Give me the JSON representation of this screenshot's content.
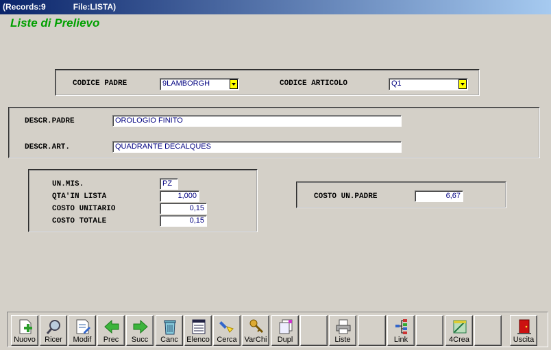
{
  "titlebar": {
    "records": "(Records:9",
    "file": "File:LISTA)"
  },
  "heading": "Liste di Prelievo",
  "codici": {
    "codice_padre_label": "CODICE PADRE",
    "codice_padre_value": "9LAMBORGH",
    "codice_articolo_label": "CODICE ARTICOLO",
    "codice_articolo_value": "Q1"
  },
  "descr": {
    "padre_label": "DESCR.PADRE",
    "padre_value": "OROLOGIO FINITO",
    "art_label": "DESCR.ART.",
    "art_value": "QUADRANTE DECALQUES"
  },
  "qty": {
    "unmis_label": "UN.MIS.",
    "unmis_value": "PZ",
    "qta_label": "QTA'IN LISTA",
    "qta_value": "1,000",
    "costo_unit_label": "COSTO UNITARIO",
    "costo_unit_value": "0,15",
    "costo_tot_label": "COSTO TOTALE",
    "costo_tot_value": "0,15"
  },
  "padre_cost": {
    "label": "COSTO UN.PADRE",
    "value": "6,67"
  },
  "toolbar": {
    "nuovo": "Nuovo",
    "ricer": "Ricer",
    "modif": "Modif",
    "prec": "Prec",
    "succ": "Succ",
    "canc": "Canc",
    "elenco": "Elenco",
    "cerca": "Cerca",
    "varchi": "VarChi",
    "dupl": "Dupl",
    "liste": "Liste",
    "link": "Link",
    "crea": "4Crea",
    "uscita": "Uscita"
  }
}
